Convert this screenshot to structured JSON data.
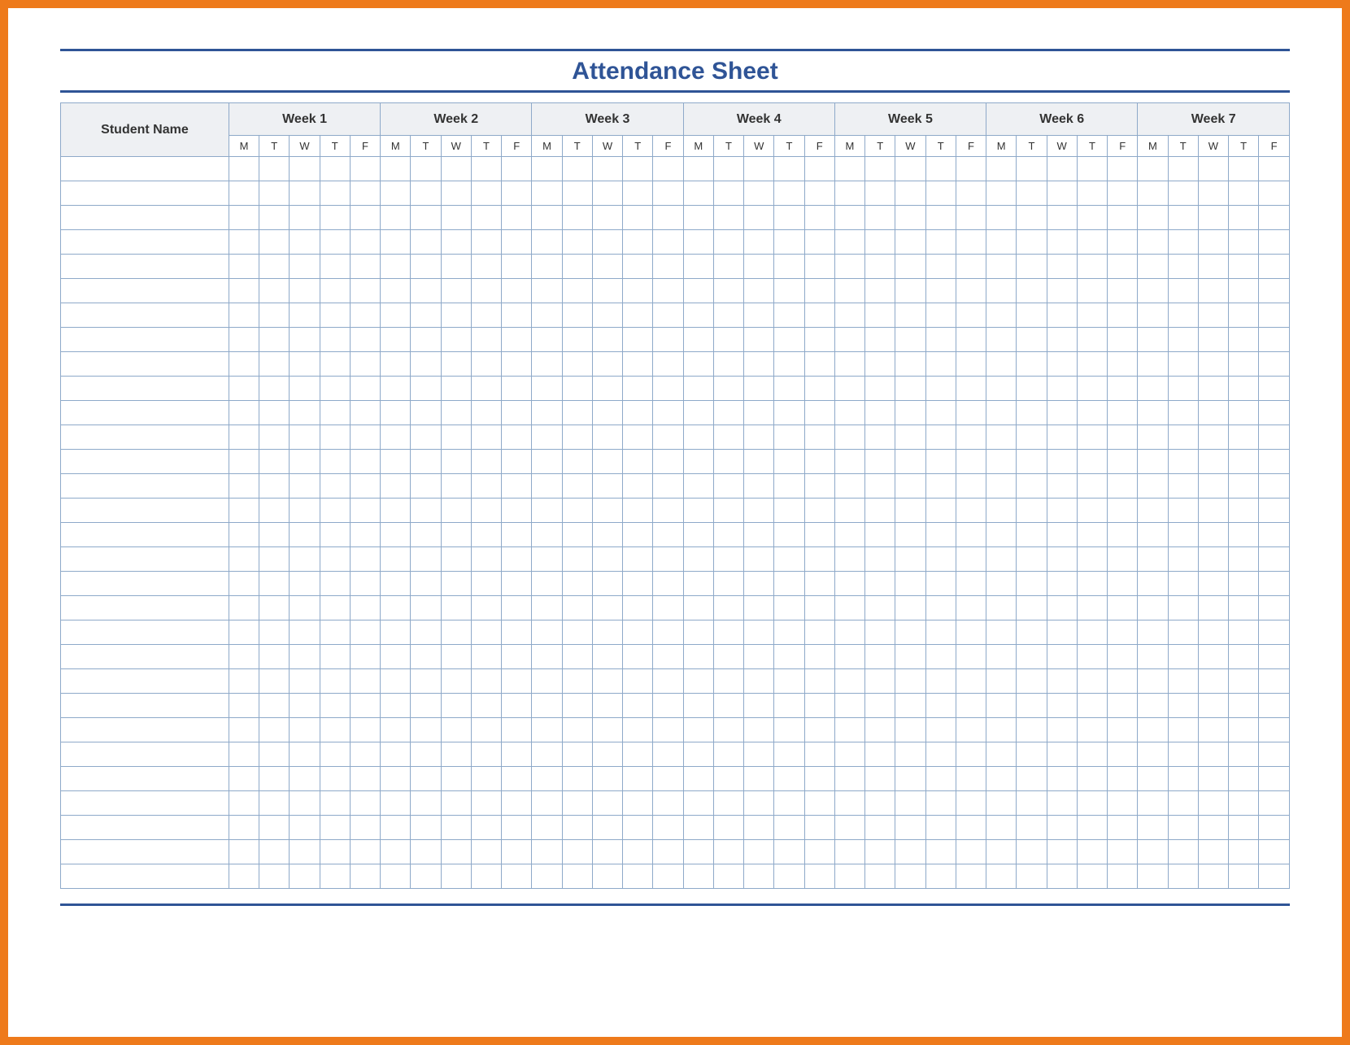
{
  "title": "Attendance Sheet",
  "name_header": "Student Name",
  "weeks": [
    "Week 1",
    "Week 2",
    "Week 3",
    "Week 4",
    "Week 5",
    "Week 6",
    "Week 7"
  ],
  "days": [
    "M",
    "T",
    "W",
    "T",
    "F"
  ],
  "row_count": 30
}
